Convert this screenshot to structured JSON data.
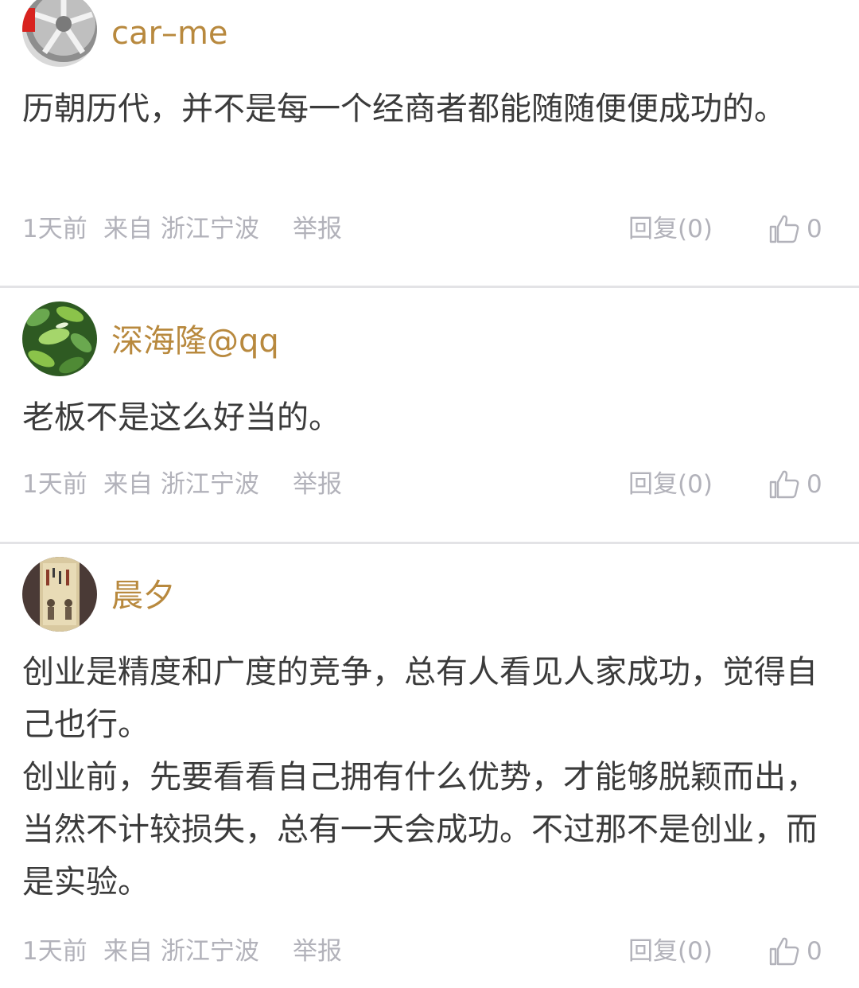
{
  "comments": [
    {
      "username": "car–me",
      "avatar_icon": "car-wheel-avatar",
      "content": [
        "历朝历代，并不是每一个经商者都能随随便便成功的。"
      ],
      "time": "1天前",
      "location": "来自 浙江宁波",
      "report_label": "举报",
      "reply_label": "回复(0)",
      "like_count": "0"
    },
    {
      "username": "深海隆@qq",
      "avatar_icon": "green-leaves-avatar",
      "content": [
        "老板不是这么好当的。"
      ],
      "time": "1天前",
      "location": "来自 浙江宁波",
      "report_label": "举报",
      "reply_label": "回复(0)",
      "like_count": "0"
    },
    {
      "username": "晨夕",
      "avatar_icon": "antique-vase-avatar",
      "content": [
        "创业是精度和广度的竞争，总有人看见人家成功，觉得自己也行。",
        "创业前，先要看看自己拥有什么优势，才能够脱颖而出，当然不计较损失，总有一天会成功。不过那不是创业，而是实验。"
      ],
      "time": "1天前",
      "location": "来自 浙江宁波",
      "report_label": "举报",
      "reply_label": "回复(0)",
      "like_count": "0"
    }
  ],
  "colors": {
    "username": "#b8893e",
    "content": "#3b3b3b",
    "meta": "#b2b2ba",
    "divider": "#e3e3e6"
  }
}
